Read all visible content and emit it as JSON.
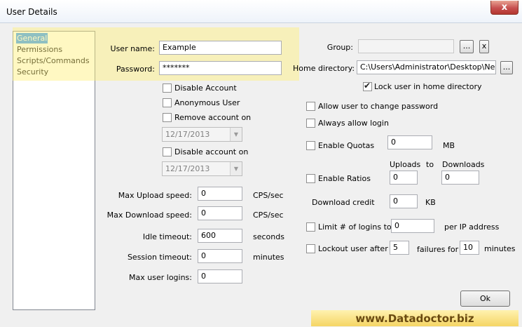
{
  "window": {
    "title": "User Details",
    "close_glyph": "x"
  },
  "nav": {
    "items": [
      {
        "label": "General",
        "selected": true
      },
      {
        "label": "Permissions",
        "selected": false
      },
      {
        "label": "Scripts/Commands",
        "selected": false
      },
      {
        "label": "Security",
        "selected": false
      }
    ]
  },
  "account": {
    "username_label": "User name:",
    "username_value": "Example",
    "password_label": "Password:",
    "password_value": "*******",
    "disable_account_label": "Disable Account",
    "anonymous_user_label": "Anonymous User",
    "remove_account_on_label": "Remove account on",
    "remove_date": "12/17/2013",
    "disable_account_on_label": "Disable account on",
    "disable_date": "12/17/2013"
  },
  "limits": {
    "max_upload_label": "Max Upload speed:",
    "max_upload_value": "0",
    "max_upload_unit": "CPS/sec",
    "max_download_label": "Max Download speed:",
    "max_download_value": "0",
    "max_download_unit": "CPS/sec",
    "idle_timeout_label": "Idle timeout:",
    "idle_timeout_value": "600",
    "idle_timeout_unit": "seconds",
    "session_timeout_label": "Session timeout:",
    "session_timeout_value": "0",
    "session_timeout_unit": "minutes",
    "max_logins_label": "Max user logins:",
    "max_logins_value": "0"
  },
  "right": {
    "group_label": "Group:",
    "group_value": "",
    "browse_label": "...",
    "clear_label": "x",
    "home_dir_label": "Home directory:",
    "home_dir_value": "C:\\Users\\Administrator\\Desktop\\New fc",
    "home_browse_label": "...",
    "lock_home_label": "Lock user in home directory",
    "lock_home_checked": true,
    "allow_change_pw_label": "Allow user to change password",
    "always_allow_login_label": "Always allow login",
    "enable_quotas_label": "Enable Quotas",
    "quota_value": "0",
    "quota_unit": "MB",
    "uploads_label": "Uploads",
    "to_label": "to",
    "downloads_label": "Downloads",
    "enable_ratios_label": "Enable Ratios",
    "ratio_uploads_value": "0",
    "ratio_downloads_value": "0",
    "download_credit_label": "Download credit",
    "download_credit_value": "0",
    "download_credit_unit": "KB",
    "limit_logins_label": "Limit # of logins to",
    "limit_logins_value": "0",
    "limit_logins_suffix": "per IP address",
    "lockout_label": "Lockout user after",
    "lockout_failures_value": "5",
    "failures_for_label": "failures for",
    "lockout_minutes_value": "10",
    "minutes_label": "minutes"
  },
  "ok_label": "Ok",
  "brand_text": "www.Datadoctor.biz"
}
